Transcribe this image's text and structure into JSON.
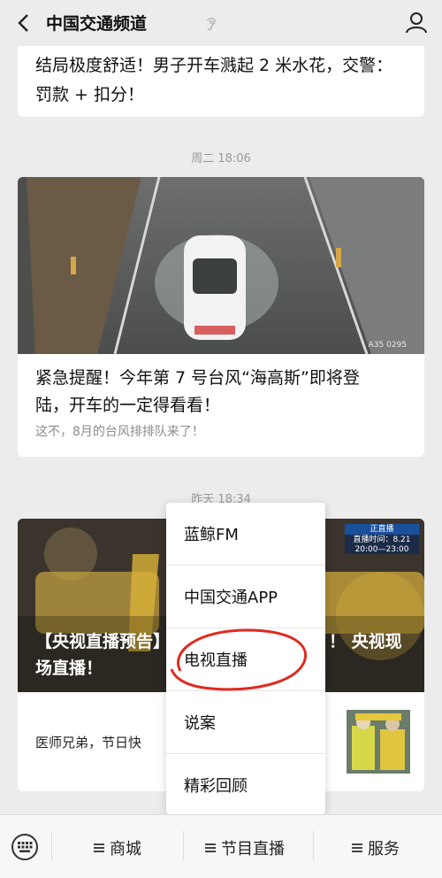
{
  "header": {
    "title": "中国交通频道",
    "back_icon": "back-arrow-icon",
    "ear_icon": "ear-icon",
    "user_icon": "user-icon"
  },
  "articles": [
    {
      "title_lines": [
        "结局极度舒适！男子开车溅起 2 米水花，交警：",
        "罚款 + 扣分！"
      ]
    },
    {
      "timestamp": "周二 18:06",
      "title_lines": [
        "紧急提醒！今年第 7 号台风“海高斯”即将登",
        "陆，开车的一定得看看！"
      ],
      "subtitle": "这不，8月的台风排排队来了！",
      "image_watermark": "A35 0295"
    },
    {
      "timestamp": "昨天 18:34",
      "overlay_title_lines": [
        "【央视直播预告】",
        "场直播！"
      ],
      "overlay_title_right": "！ 央视现",
      "badge_line1": "正直播",
      "badge_line2": "直播时间：8.21",
      "badge_line3": "20:00—23:00",
      "row_text": "医师兄弟，节日快"
    }
  ],
  "popup_menu": {
    "items": [
      "蓝鲸FM",
      "中国交通APP",
      "电视直播",
      "说案",
      "精彩回顾"
    ],
    "highlighted": "电视直播",
    "highlight_color": "#e02a1f"
  },
  "bottom_bar": {
    "keyboard_icon": "keyboard-icon",
    "items": [
      "商城",
      "节目直播",
      "服务"
    ]
  }
}
